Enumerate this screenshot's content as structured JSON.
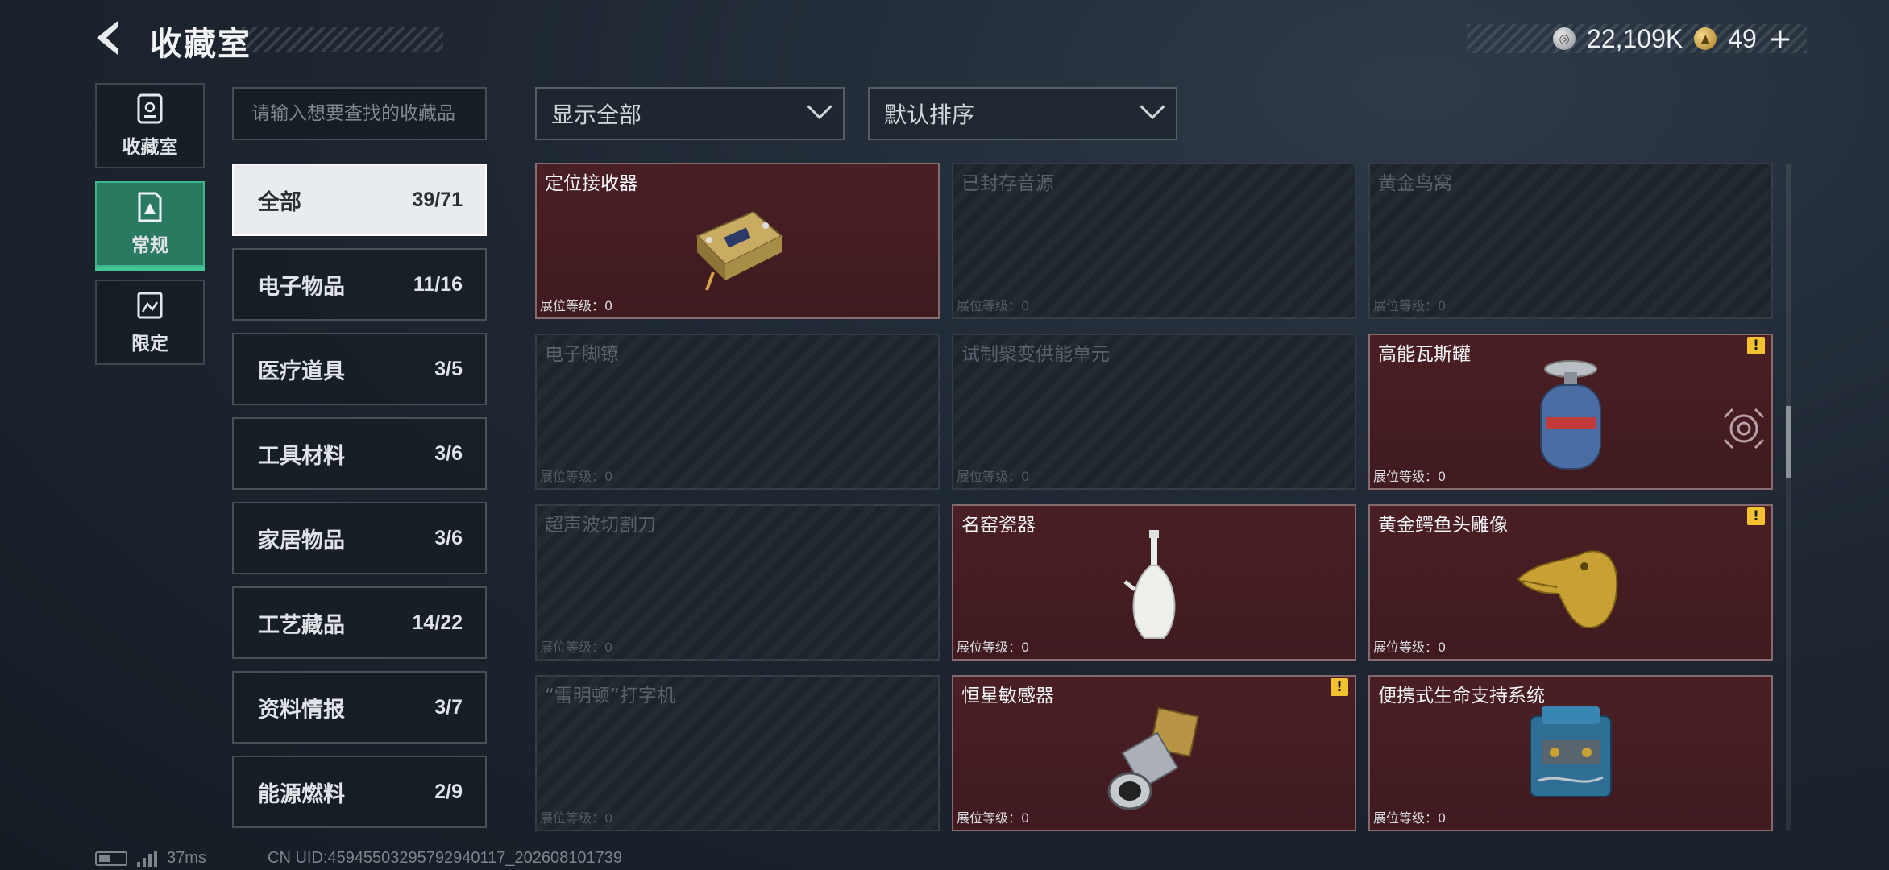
{
  "header": {
    "title": "收藏室",
    "currency": [
      {
        "icon": "silver-coin-icon",
        "value": "22,109K"
      },
      {
        "icon": "gold-coin-icon",
        "value": "49"
      }
    ],
    "plus_label": "+"
  },
  "side_tabs": [
    {
      "label": "收藏室",
      "icon": "collection-room-icon",
      "active": false
    },
    {
      "label": "常规",
      "icon": "regular-icon",
      "active": true
    },
    {
      "label": "限定",
      "icon": "limited-icon",
      "active": false
    }
  ],
  "search": {
    "placeholder": "请输入想要查找的收藏品"
  },
  "filters": {
    "display": "显示全部",
    "sort": "默认排序"
  },
  "categories": [
    {
      "name": "全部",
      "count": "39/71",
      "active": true
    },
    {
      "name": "电子物品",
      "count": "11/16"
    },
    {
      "name": "医疗道具",
      "count": "3/5"
    },
    {
      "name": "工具材料",
      "count": "3/6"
    },
    {
      "name": "家居物品",
      "count": "3/6"
    },
    {
      "name": "工艺藏品",
      "count": "14/22"
    },
    {
      "name": "资料情报",
      "count": "3/7"
    },
    {
      "name": "能源燃料",
      "count": "2/9"
    }
  ],
  "level_label": "展位等级：0",
  "items": [
    {
      "name": "定位接收器",
      "owned": true,
      "warn": false
    },
    {
      "name": "已封存音源",
      "owned": false,
      "warn": false
    },
    {
      "name": "黄金鸟窝",
      "owned": false,
      "warn": false
    },
    {
      "name": "电子脚镣",
      "owned": false,
      "warn": false
    },
    {
      "name": "试制聚变供能单元",
      "owned": false,
      "warn": false
    },
    {
      "name": "高能瓦斯罐",
      "owned": true,
      "warn": true
    },
    {
      "name": "超声波切割刀",
      "owned": false,
      "warn": false
    },
    {
      "name": "名窑瓷器",
      "owned": true,
      "warn": false
    },
    {
      "name": "黄金鳄鱼头雕像",
      "owned": true,
      "warn": true
    },
    {
      "name": "“雷明顿”打字机",
      "owned": false,
      "warn": false
    },
    {
      "name": "恒星敏感器",
      "owned": true,
      "warn": true
    },
    {
      "name": "便携式生命支持系统",
      "owned": true,
      "warn": false
    }
  ],
  "status": {
    "ping": "37ms",
    "uid": "CN UID:45945503295792940117_202608101739"
  },
  "colors": {
    "owned_card": "#4a1f24",
    "active_tab": "#2a7a62",
    "warn": "#f2c230"
  }
}
